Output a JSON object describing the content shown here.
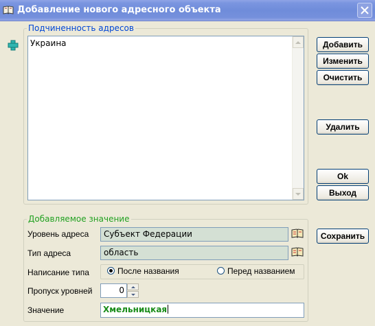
{
  "window": {
    "title": "Добавление нового адресного объекта"
  },
  "icons": {
    "app": "book-icon",
    "add": "plus-icon",
    "close": "close-icon",
    "lookup": "book-icon"
  },
  "subordination": {
    "legend": "Подчиненность адресов",
    "items": [
      "Украина"
    ]
  },
  "buttons": {
    "add": "Добавить",
    "edit": "Изменить",
    "clear": "Очистить",
    "delete": "Удалить",
    "ok": "Ok",
    "exit": "Выход",
    "save": "Сохранить"
  },
  "new_value": {
    "legend": "Добавляемое значение",
    "level_label": "Уровень адреса",
    "level_value": "Субъект Федерации",
    "type_label": "Тип адреса",
    "type_value": "область",
    "spelling_label": "Написание типа",
    "spelling_options": [
      "После названия",
      "Перед названием"
    ],
    "spelling_selected": "После названия",
    "skip_label": "Пропуск уровней",
    "skip_value": "0",
    "value_label": "Значение",
    "value": "Хмельницкая"
  },
  "colors": {
    "accent_blue": "#0046d5",
    "accent_green": "#21a121",
    "value_text": "#198c19",
    "readonly_field": "#d4e0d4"
  }
}
